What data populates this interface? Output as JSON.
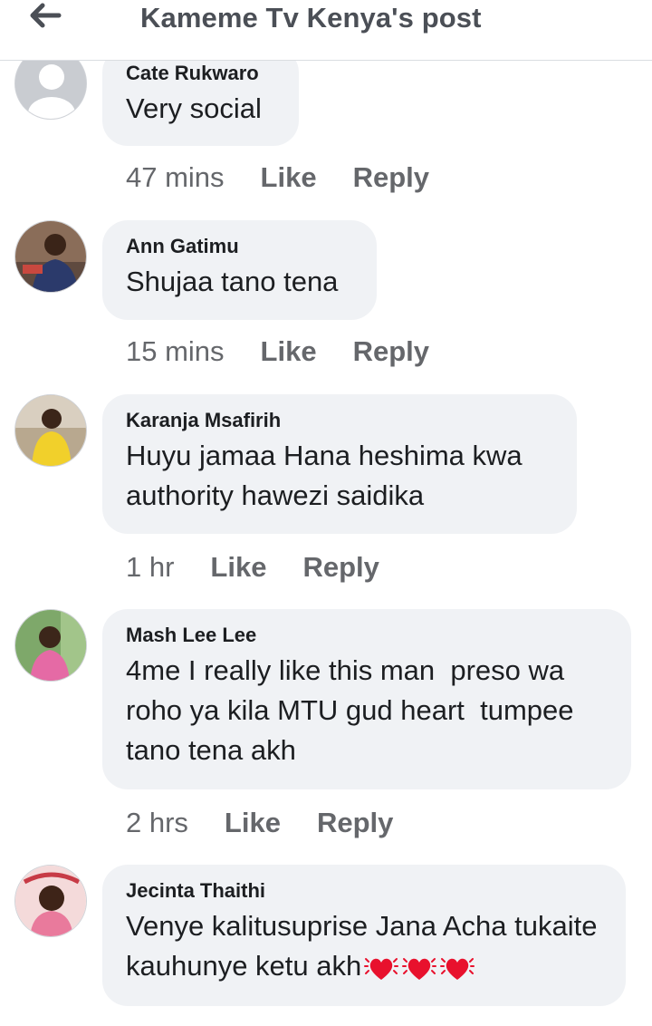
{
  "header": {
    "title": "Kameme Tv Kenya's post"
  },
  "comments": [
    {
      "author": "Cate Rukwaro",
      "text": "Very social",
      "time": "47 mins",
      "like": "Like",
      "reply": "Reply"
    },
    {
      "author": "Ann Gatimu",
      "text": "Shujaa tano tena",
      "time": "15 mins",
      "like": "Like",
      "reply": "Reply"
    },
    {
      "author": "Karanja Msafirih",
      "text": "Huyu jamaa Hana heshima kwa authority hawezi saidika",
      "time": "1 hr",
      "like": "Like",
      "reply": "Reply"
    },
    {
      "author": "Mash Lee Lee",
      "text": "4me I really like this man  preso wa roho ya kila MTU gud heart  tumpee tano tena akh",
      "time": "2 hrs",
      "like": "Like",
      "reply": "Reply"
    },
    {
      "author": "Jecinta Thaithi",
      "text": "Venye kalitusuprise Jana Acha tukaite kauhunye ketu akh",
      "time": "",
      "like": "",
      "reply": ""
    }
  ],
  "emoji": {
    "name": "beating-heart-icon",
    "color": "#e8112d",
    "count": 3
  },
  "colors": {
    "bubble": "#f0f2f5",
    "meta": "#65676b",
    "header_title": "#4b4f56"
  }
}
